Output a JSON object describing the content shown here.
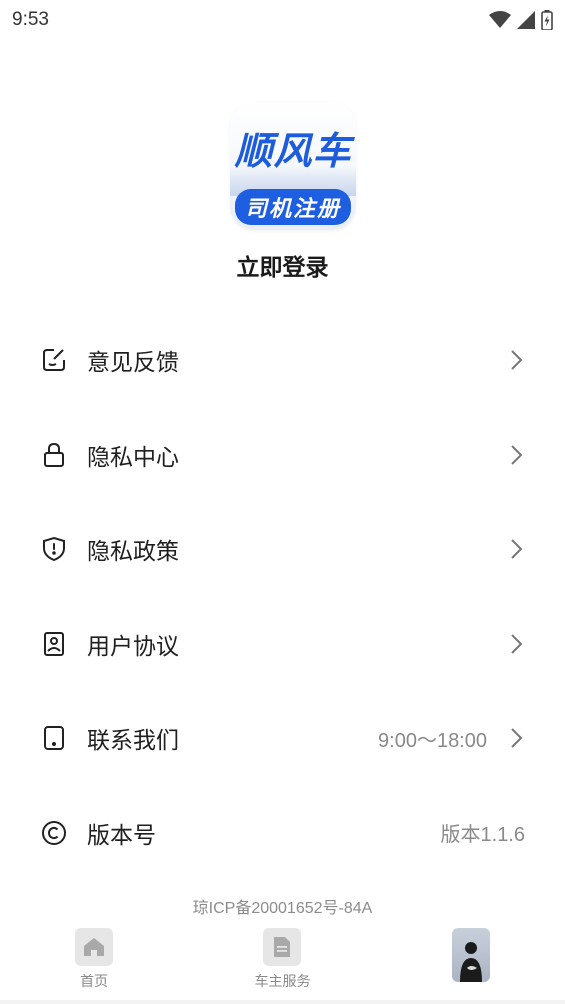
{
  "status_bar": {
    "time": "9:53"
  },
  "logo": {
    "top_text": "顺风车",
    "bottom_text": "司机注册"
  },
  "login": {
    "label": "立即登录"
  },
  "menu": [
    {
      "icon": "feedback-edit-icon",
      "label": "意见反馈",
      "value": ""
    },
    {
      "icon": "lock-icon",
      "label": "隐私中心",
      "value": ""
    },
    {
      "icon": "shield-icon",
      "label": "隐私政策",
      "value": ""
    },
    {
      "icon": "user-agreement-icon",
      "label": "用户协议",
      "value": ""
    },
    {
      "icon": "phone-icon",
      "label": "联系我们",
      "value": "9:00～18:00"
    },
    {
      "icon": "copyright-icon",
      "label": "版本号",
      "value": "版本1.1.6"
    }
  ],
  "icp": "琼ICP备20001652号-84A",
  "tabbar": [
    {
      "icon": "home-icon",
      "label": "首页"
    },
    {
      "icon": "document-icon",
      "label": "车主服务"
    },
    {
      "icon": "avatar-icon",
      "label": ""
    }
  ],
  "colors": {
    "brand_blue": "#1e5ee0",
    "text": "#1f1f1f",
    "muted": "#8a8a8a"
  }
}
